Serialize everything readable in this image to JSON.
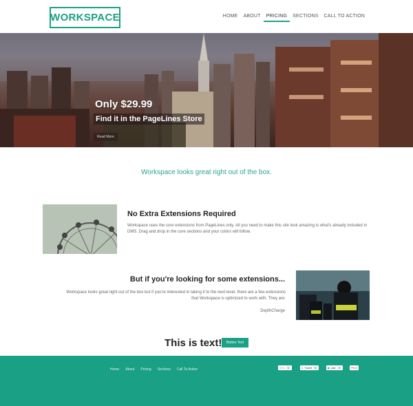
{
  "header": {
    "logo": "WORKSPACE",
    "nav": [
      "HOME",
      "ABOUT",
      "PRICING",
      "SECTIONS",
      "CALL TO ACTION"
    ],
    "active_nav": "PRICING"
  },
  "hero": {
    "title": "Only $29.99",
    "subtitle": "Find it in the PageLines Store",
    "button": "Read More"
  },
  "tagline": "Workspace looks great right out of the box.",
  "feature1": {
    "title": "No Extra Extensions Required",
    "text": "Workspace uses the core extensions from PageLines only. All you need to make this site look amazing is what's already included in DMS. Drag and drop in the core sections and your colors will follow."
  },
  "feature2": {
    "title": "But if you're looking for some extensions...",
    "text": "Workspace looks great right out of the box but if you're interested in taking it to the next level, there are a few extensions that Workspace is optimized to work with. They are:",
    "link": "DepthCharge"
  },
  "callout": {
    "text": "This is text!",
    "button": "Button Text"
  },
  "footer": {
    "nav": [
      "Home",
      "About",
      "Pricing",
      "Sections",
      "Call To Action"
    ],
    "social": [
      {
        "label": "G+1",
        "count": "0"
      },
      {
        "label": "Tweet",
        "count": "0"
      },
      {
        "label": "Like",
        "count": "0"
      },
      {
        "label": "Pin it",
        "count": ""
      }
    ]
  },
  "colors": {
    "accent": "#1aa084",
    "tagline": "#2aa58a"
  }
}
